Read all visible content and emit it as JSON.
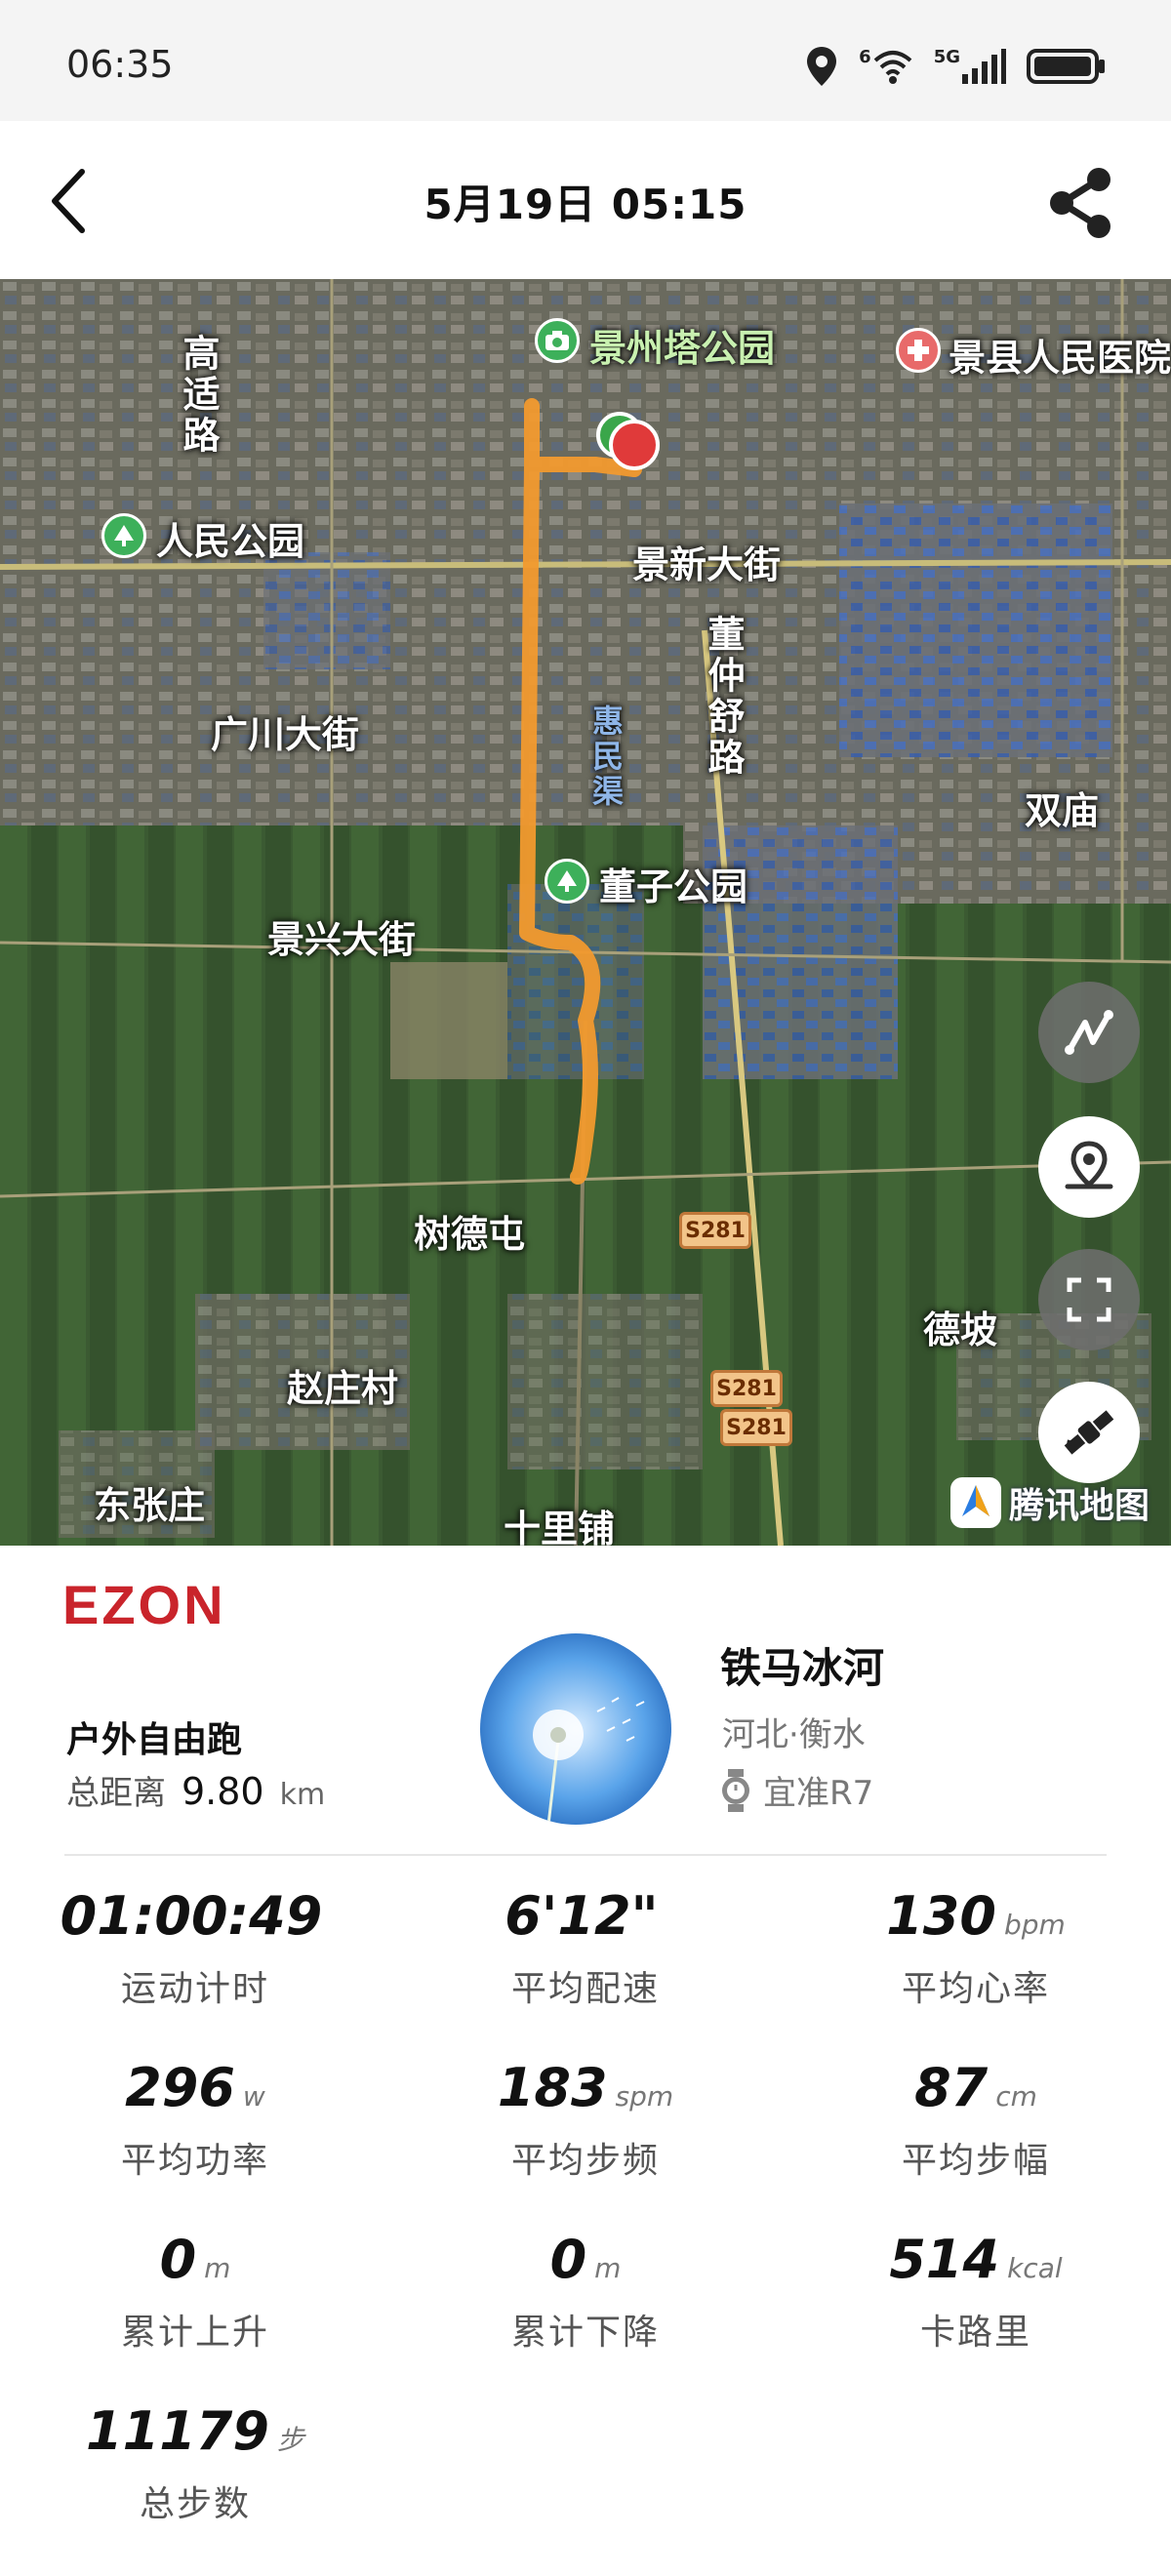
{
  "status_bar": {
    "time": "06:35",
    "wifi_label": "6",
    "network_label": "5G"
  },
  "header": {
    "title": "5月19日  05:15"
  },
  "map": {
    "labels": {
      "park_jingzhouta": "景州塔公园",
      "hospital": "景县人民医院",
      "gaoshi_road": "高适路",
      "renmin_park": "人民公园",
      "jingxin_street": "景新大街",
      "guangchuan_street": "广川大街",
      "dongzhongshu_road": "董仲舒路",
      "huimin_canal": "惠民渠",
      "shuangmiao": "双庙",
      "dongzi_park": "董子公园",
      "jingxing_street": "景兴大街",
      "shudetun": "树德屯",
      "dezhuang": "德坡",
      "zhaozhuang": "赵庄村",
      "dongzhangzhuang": "东张庄",
      "shilipu": "十里铺",
      "shield_1": "S281",
      "shield_2": "S281",
      "shield_3": "S281",
      "provider": "腾讯地图"
    },
    "icons": {
      "track_button": "route-icon",
      "locate_button": "location-pin-icon",
      "fullscreen_button": "fullscreen-icon",
      "satellite_button": "satellite-icon"
    },
    "colors": {
      "track": "#f29a2e",
      "start_marker": "#3aa64a",
      "end_marker": "#e03a3a"
    }
  },
  "summary": {
    "brand": "EZON",
    "sport_type": "户外自由跑",
    "distance_label": "总距离",
    "distance_value": "9.80",
    "distance_unit": "km",
    "user_name": "铁马冰河",
    "user_location": "河北·衡水",
    "device_name": "宜准R7"
  },
  "stats": [
    {
      "value": "01:00:49",
      "unit": "",
      "label": "运动计时"
    },
    {
      "value": "6'12\"",
      "unit": "",
      "label": "平均配速"
    },
    {
      "value": "130",
      "unit": "bpm",
      "label": "平均心率"
    },
    {
      "value": "296",
      "unit": "w",
      "label": "平均功率"
    },
    {
      "value": "183",
      "unit": "spm",
      "label": "平均步频"
    },
    {
      "value": "87",
      "unit": "cm",
      "label": "平均步幅"
    },
    {
      "value": "0",
      "unit": "m",
      "label": "累计上升"
    },
    {
      "value": "0",
      "unit": "m",
      "label": "累计下降"
    },
    {
      "value": "514",
      "unit": "kcal",
      "label": "卡路里"
    },
    {
      "value": "11179",
      "unit": "步",
      "label": "总步数"
    }
  ]
}
